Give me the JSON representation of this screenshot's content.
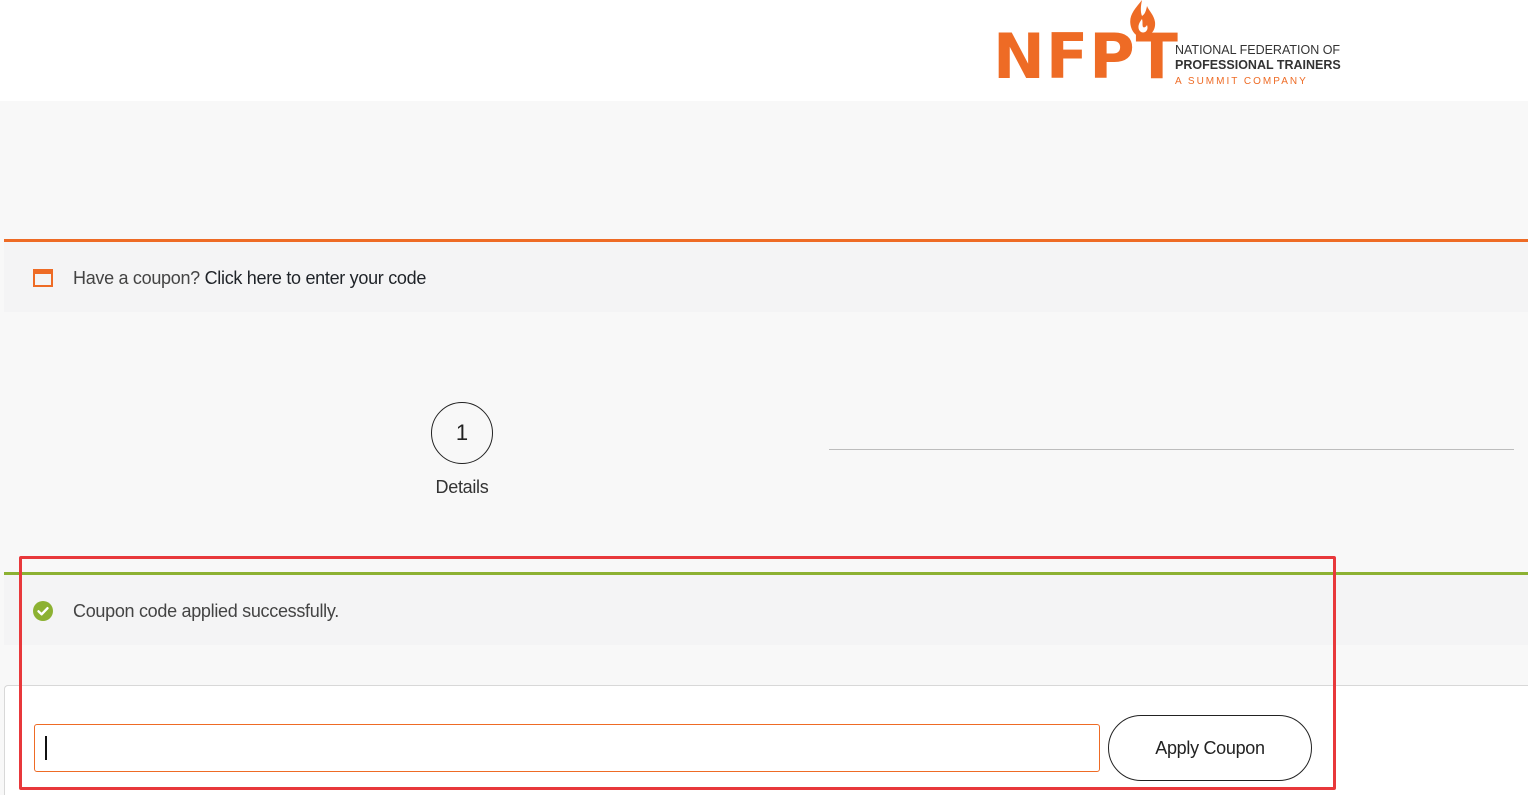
{
  "brand": {
    "logo_letters": "NFPT",
    "line1": "NATIONAL FEDERATION OF",
    "line2": "PROFESSIONAL TRAINERS",
    "line3": "A SUMMIT COMPANY",
    "color": "#ee6b25"
  },
  "coupon_notice": {
    "prefix": "Have a coupon?",
    "link": "Click here to enter your code",
    "icon": "window-icon",
    "accent": "#ee6b25"
  },
  "steps": [
    {
      "number": "1",
      "label": "Details"
    }
  ],
  "success_notice": {
    "text": "Coupon code applied successfully.",
    "icon": "check-circle-icon",
    "accent": "#8cb132"
  },
  "coupon_form": {
    "input_value": "",
    "input_placeholder": "",
    "button_label": "Apply Coupon"
  },
  "annotation": {
    "color": "#e8383b"
  }
}
